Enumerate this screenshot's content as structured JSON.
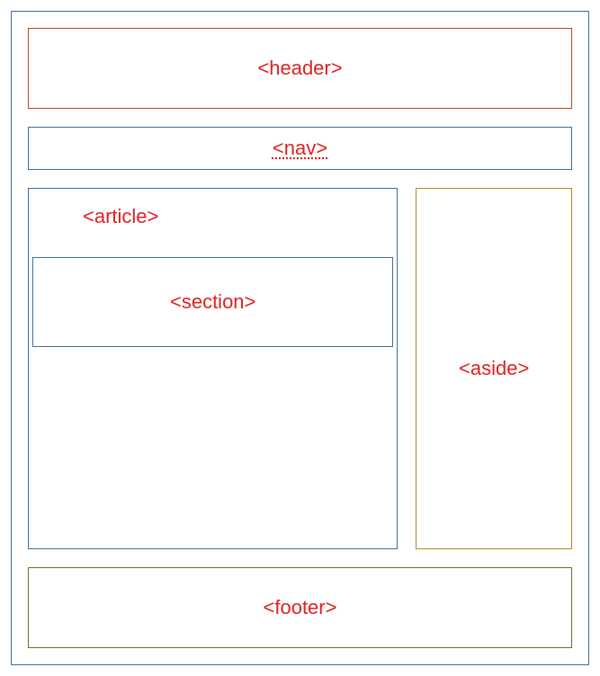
{
  "labels": {
    "header": "<header>",
    "nav": "<nav>",
    "article": "<article>",
    "section": "<section>",
    "aside": "<aside>",
    "footer": "<footer>"
  }
}
